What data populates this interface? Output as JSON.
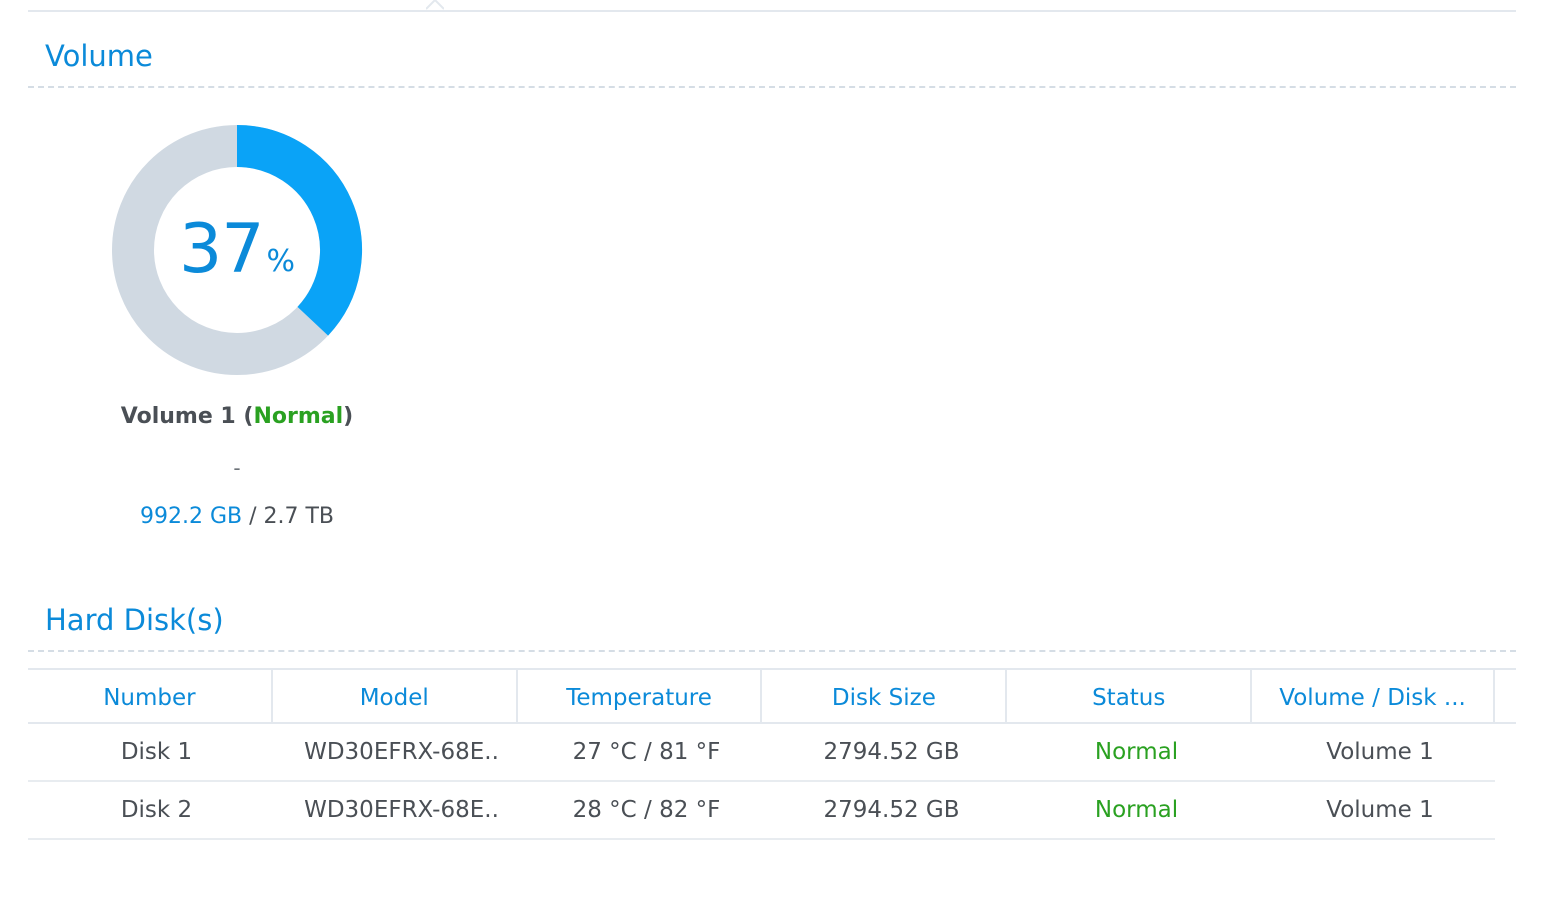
{
  "volume_section": {
    "title": "Volume"
  },
  "volume": {
    "usage_percent": 37,
    "usage_number": "37",
    "percent_sign": "%",
    "name_prefix": "Volume 1 (",
    "status": "Normal",
    "name_suffix": ")",
    "subtitle": "-",
    "used": "992.2 GB",
    "separator": " / ",
    "total": "2.7 TB",
    "colors": {
      "used": "#0aa3f7",
      "free": "#d0d9e2",
      "normal": "#2aa121",
      "accent": "#0b8ad9"
    }
  },
  "disks_section": {
    "title": "Hard Disk(s)"
  },
  "disk_table": {
    "headers": [
      "Number",
      "Model",
      "Temperature",
      "Disk Size",
      "Status",
      "Volume / Disk ..."
    ],
    "rows": [
      {
        "number": "Disk 1",
        "model": "WD30EFRX-68E..",
        "temperature": "27 °C / 81 °F",
        "size": "2794.52 GB",
        "status": "Normal",
        "volume": "Volume 1"
      },
      {
        "number": "Disk 2",
        "model": "WD30EFRX-68E..",
        "temperature": "28 °C / 82 °F",
        "size": "2794.52 GB",
        "status": "Normal",
        "volume": "Volume 1"
      }
    ]
  }
}
